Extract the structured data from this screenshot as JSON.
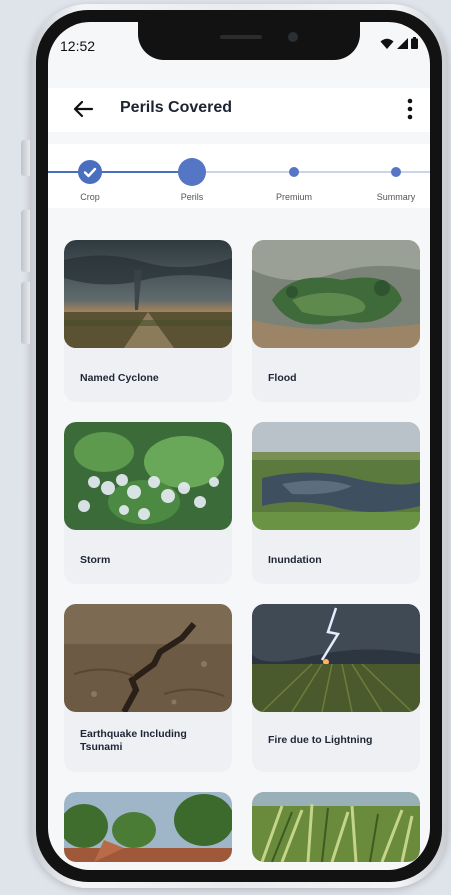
{
  "status_bar": {
    "time": "12:52",
    "icons": [
      "wifi-icon",
      "signal-icon",
      "battery-icon"
    ]
  },
  "app_bar": {
    "title": "Perils Covered",
    "back_icon": "arrow-left-icon",
    "menu_icon": "more-vertical-icon"
  },
  "stepper": {
    "steps": [
      {
        "label": "Crop",
        "state": "done"
      },
      {
        "label": "Perils",
        "state": "active"
      },
      {
        "label": "Premium",
        "state": "pending"
      },
      {
        "label": "Summary",
        "state": "pending"
      }
    ],
    "accent": "#5575c5"
  },
  "perils": [
    {
      "label": "Named Cyclone",
      "image": "tornado-over-farm-road"
    },
    {
      "label": "Flood",
      "image": "flooded-fields-aerial"
    },
    {
      "label": "Storm",
      "image": "hail-on-leaves"
    },
    {
      "label": "Inundation",
      "image": "waterlogged-field"
    },
    {
      "label": "Earthquake Including Tsunami",
      "image": "cracked-soil"
    },
    {
      "label": "Fire due to Lightning",
      "image": "lightning-over-crops"
    },
    {
      "label": "",
      "image": "eroded-landslide-trees"
    },
    {
      "label": "",
      "image": "pest-damaged-crop"
    }
  ]
}
